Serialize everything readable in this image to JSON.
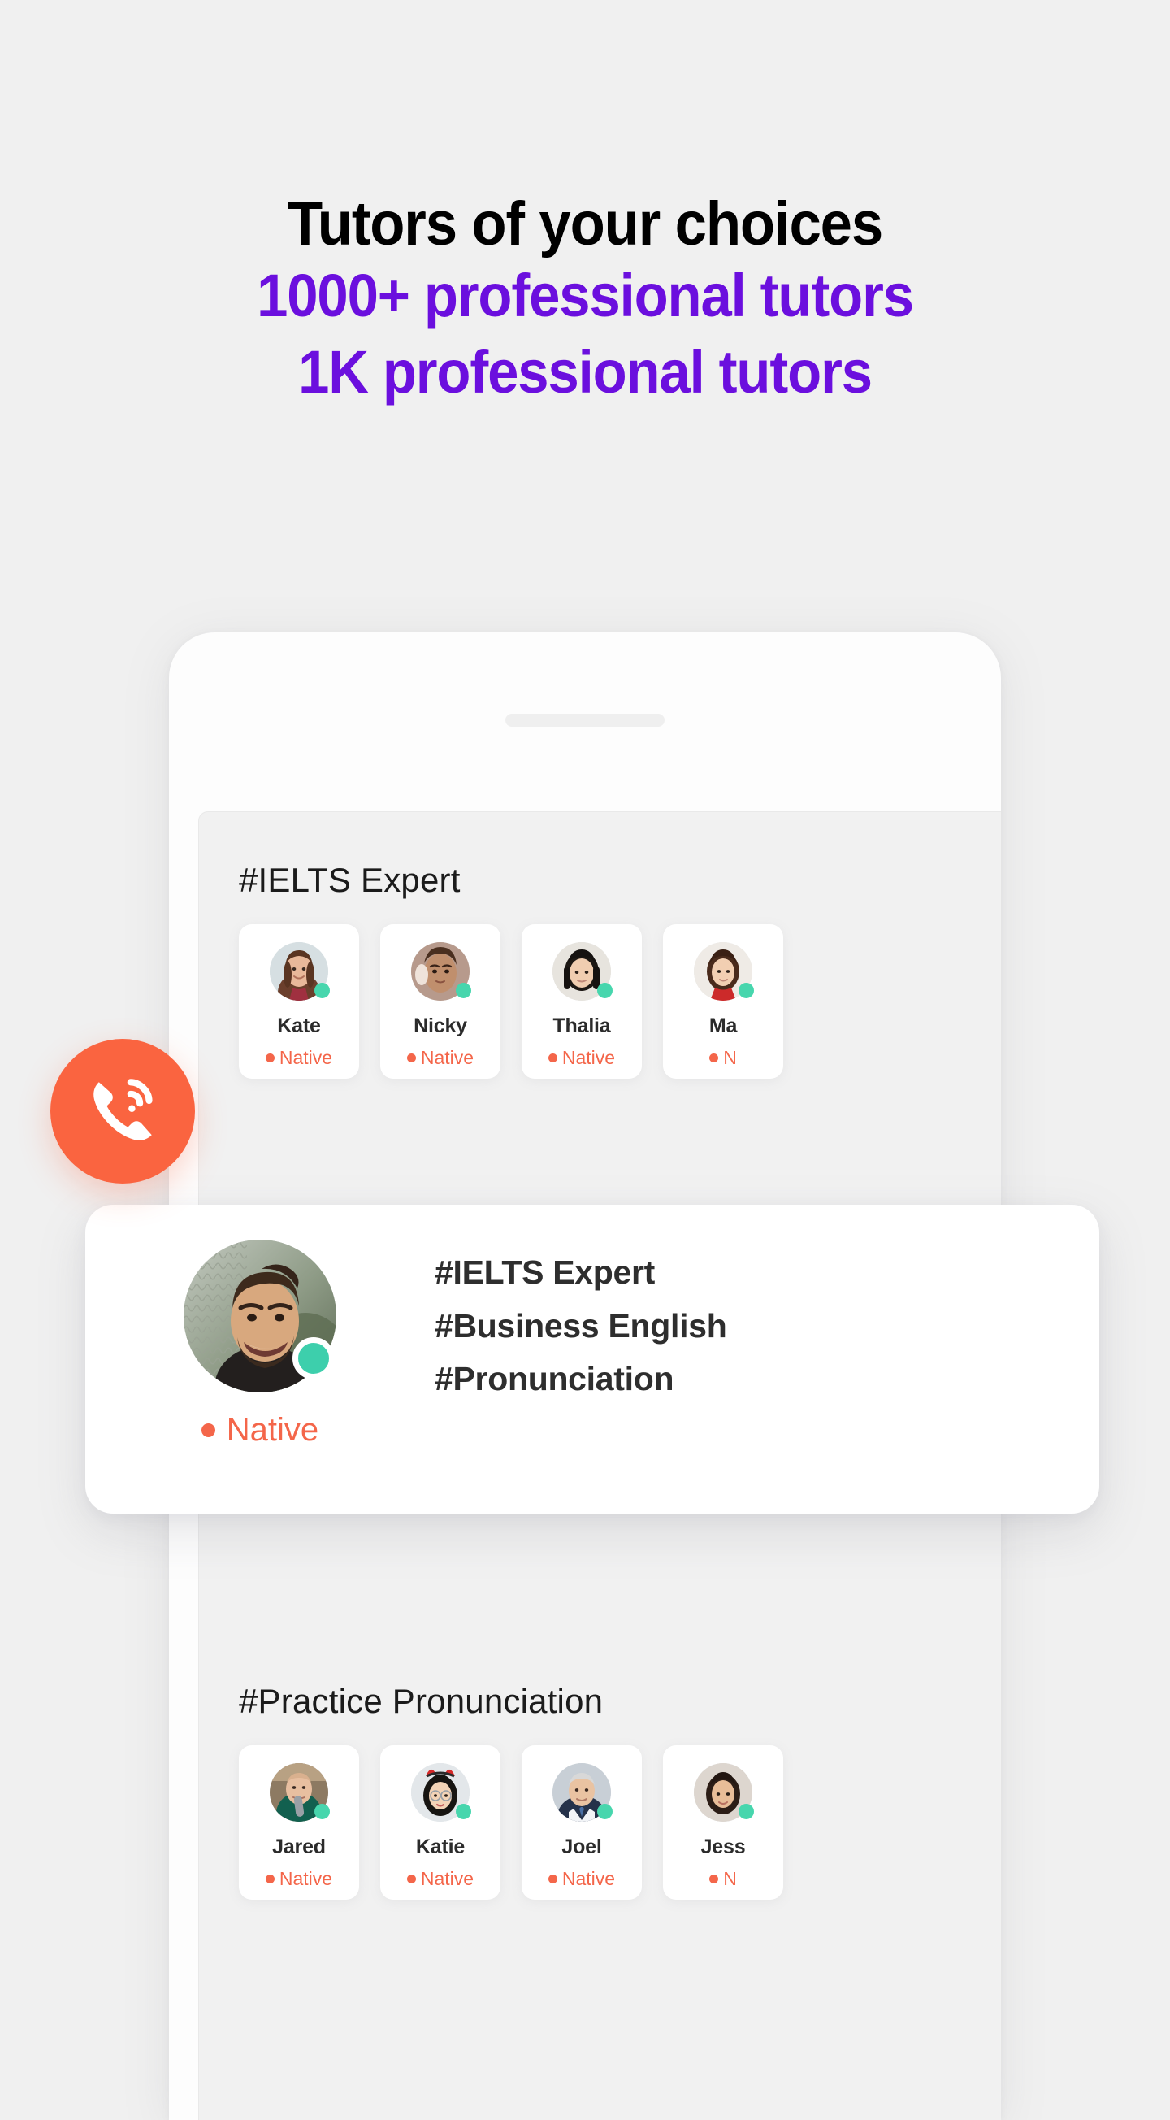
{
  "headline": {
    "line1": "Tutors of your choices",
    "line2": "1000+ professional tutors",
    "line3": "1K professional tutors",
    "accent_color": "#6B0FDE",
    "main_color": "#000000"
  },
  "phone": {
    "sections": [
      {
        "title": "#IELTS Expert",
        "cards": [
          {
            "name": "Kate",
            "status": "Native",
            "online": true
          },
          {
            "name": "Nicky",
            "status": "Native",
            "online": true
          },
          {
            "name": "Thalia",
            "status": "Native",
            "online": true
          },
          {
            "name": "Ma",
            "status": "N",
            "online": true
          }
        ]
      },
      {
        "title": "#Practice Pronunciation",
        "cards": [
          {
            "name": "Jared",
            "status": "Native",
            "online": true
          },
          {
            "name": "Katie",
            "status": "Native",
            "online": true
          },
          {
            "name": "Joel",
            "status": "Native",
            "online": true
          },
          {
            "name": "Jess",
            "status": "N",
            "online": true
          }
        ]
      }
    ]
  },
  "call_badge": {
    "icon": "phone-call-icon",
    "color": "#FA6440"
  },
  "feature_card": {
    "avatar": "tutor-avatar-male",
    "status": "Native",
    "status_color": "#F4664A",
    "online_color": "#3DCFAC",
    "tags": [
      "#IELTS Expert",
      "#Business English",
      "#Pronunciation"
    ]
  }
}
